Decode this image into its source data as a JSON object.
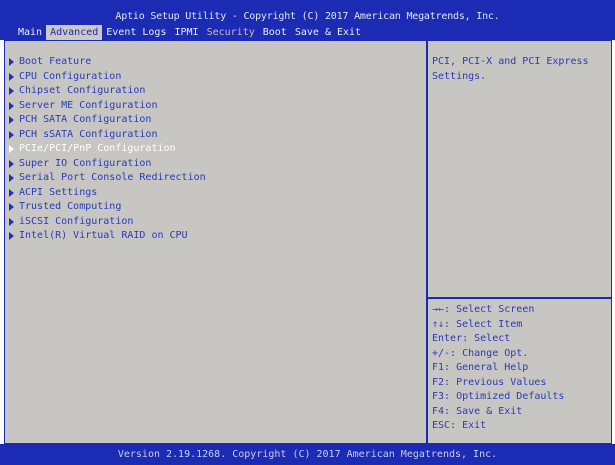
{
  "title": "Aptio Setup Utility - Copyright (C) 2017 American Megatrends, Inc.",
  "tabs": [
    "Main",
    "Advanced",
    "Event Logs",
    "IPMI",
    "Security",
    "Boot",
    "Save & Exit"
  ],
  "active_tab": "Advanced",
  "menu_items": [
    "Boot Feature",
    "CPU Configuration",
    "Chipset Configuration",
    "Server ME Configuration",
    "PCH SATA Configuration",
    "PCH sSATA Configuration",
    "PCIe/PCI/PnP Configuration",
    "Super IO Configuration",
    "Serial Port Console Redirection",
    "ACPI Settings",
    "Trusted Computing",
    "iSCSI Configuration",
    "Intel(R) Virtual RAID on CPU"
  ],
  "selected_item": "PCIe/PCI/PnP Configuration",
  "help_text": "PCI, PCI-X and PCI Express Settings.",
  "key_help": [
    "→←: Select Screen",
    "↑↓: Select Item",
    "Enter: Select",
    "+/-: Change Opt.",
    "F1: General Help",
    "F2: Previous Values",
    "F3: Optimized Defaults",
    "F4: Save & Exit",
    "ESC: Exit"
  ],
  "footer": "Version 2.19.1268. Copyright (C) 2017 American Megatrends, Inc.",
  "colors": {
    "header_bg": "#1c2bb3",
    "panel_bg": "#c8c6c2",
    "text_blue": "#2a3bb5",
    "highlight": "#ffffff"
  }
}
